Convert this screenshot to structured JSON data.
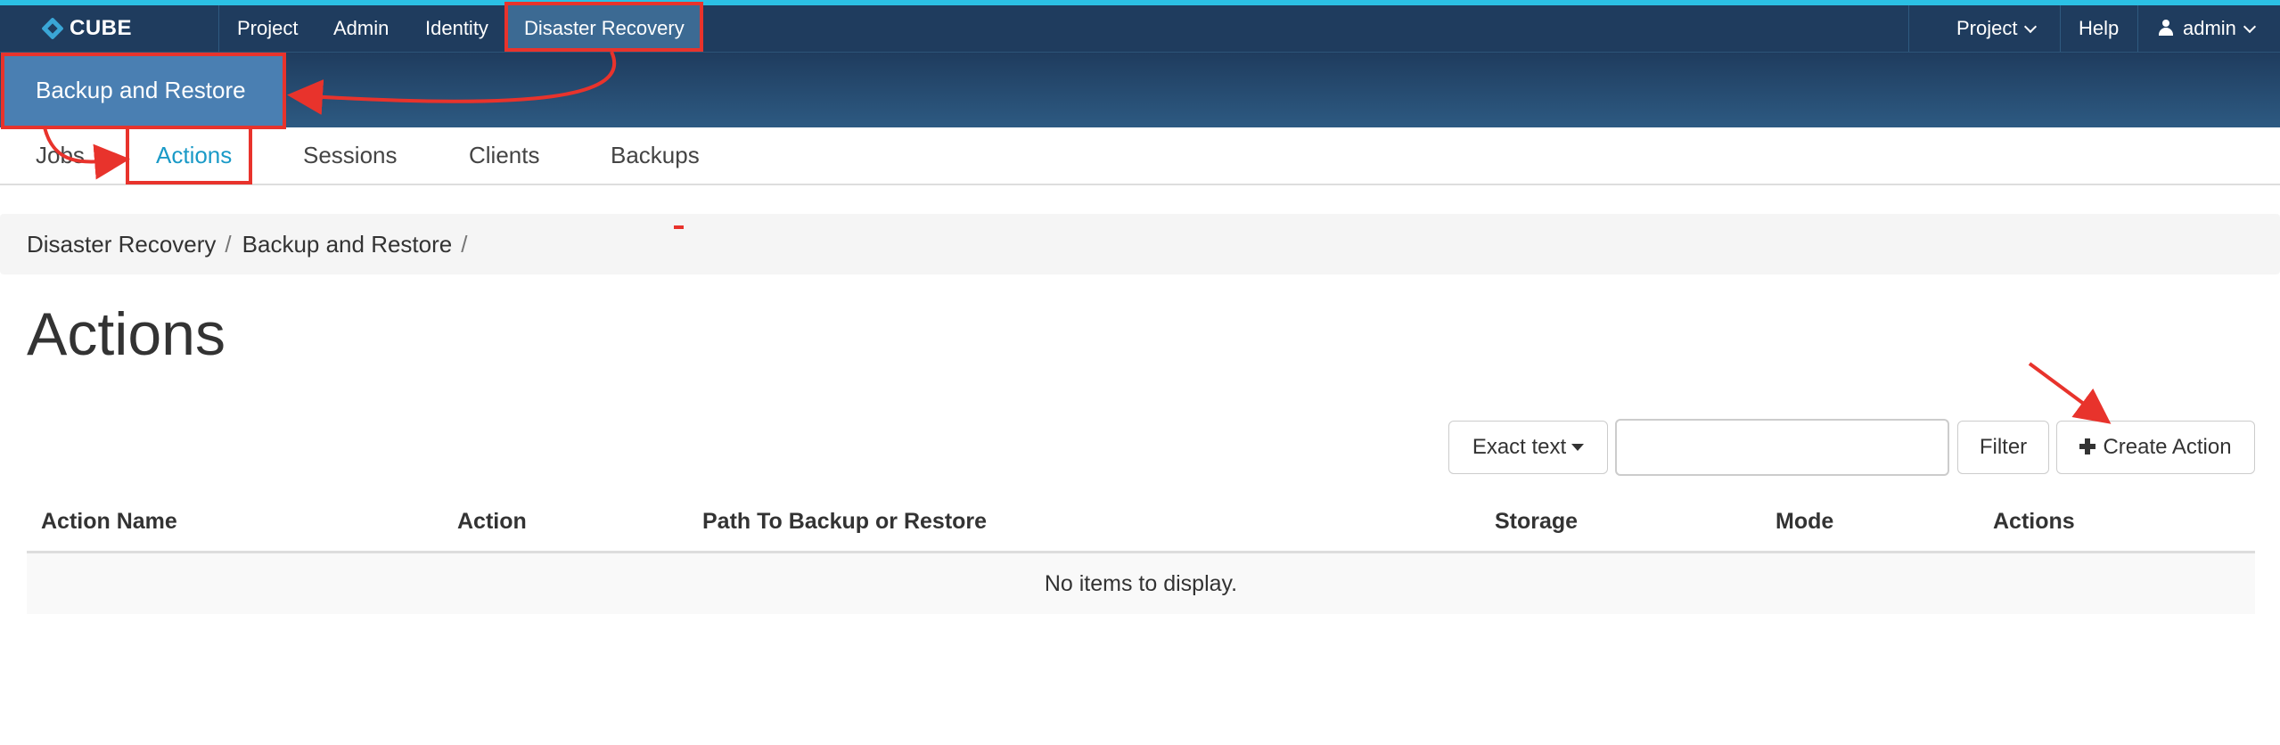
{
  "brand": {
    "name": "CUBE",
    "logo_icon": "cube-logo-icon"
  },
  "topnav": {
    "items": [
      "Project",
      "Admin",
      "Identity",
      "Disaster Recovery"
    ],
    "active": "Disaster Recovery",
    "right": {
      "project": "Project",
      "help": "Help",
      "user": "admin"
    }
  },
  "subnav": {
    "active_label": "Backup and Restore"
  },
  "tabs": {
    "items": [
      "Jobs",
      "Actions",
      "Sessions",
      "Clients",
      "Backups"
    ],
    "active": "Actions"
  },
  "breadcrumb": {
    "items": [
      "Disaster Recovery",
      "Backup and Restore"
    ],
    "separator": "/"
  },
  "page": {
    "title": "Actions"
  },
  "toolbar": {
    "filter_type": "Exact text",
    "search_value": "",
    "filter_button": "Filter",
    "create_button": "Create Action"
  },
  "table": {
    "columns": [
      "Action Name",
      "Action",
      "Path To Backup or Restore",
      "Storage",
      "Mode",
      "Actions"
    ],
    "rows": [],
    "empty_message": "No items to display."
  },
  "colors": {
    "topbar": "#1f3c5e",
    "accent": "#2bc0e4",
    "active_tab": "#1a9ac7",
    "annotation": "#e8332c"
  }
}
